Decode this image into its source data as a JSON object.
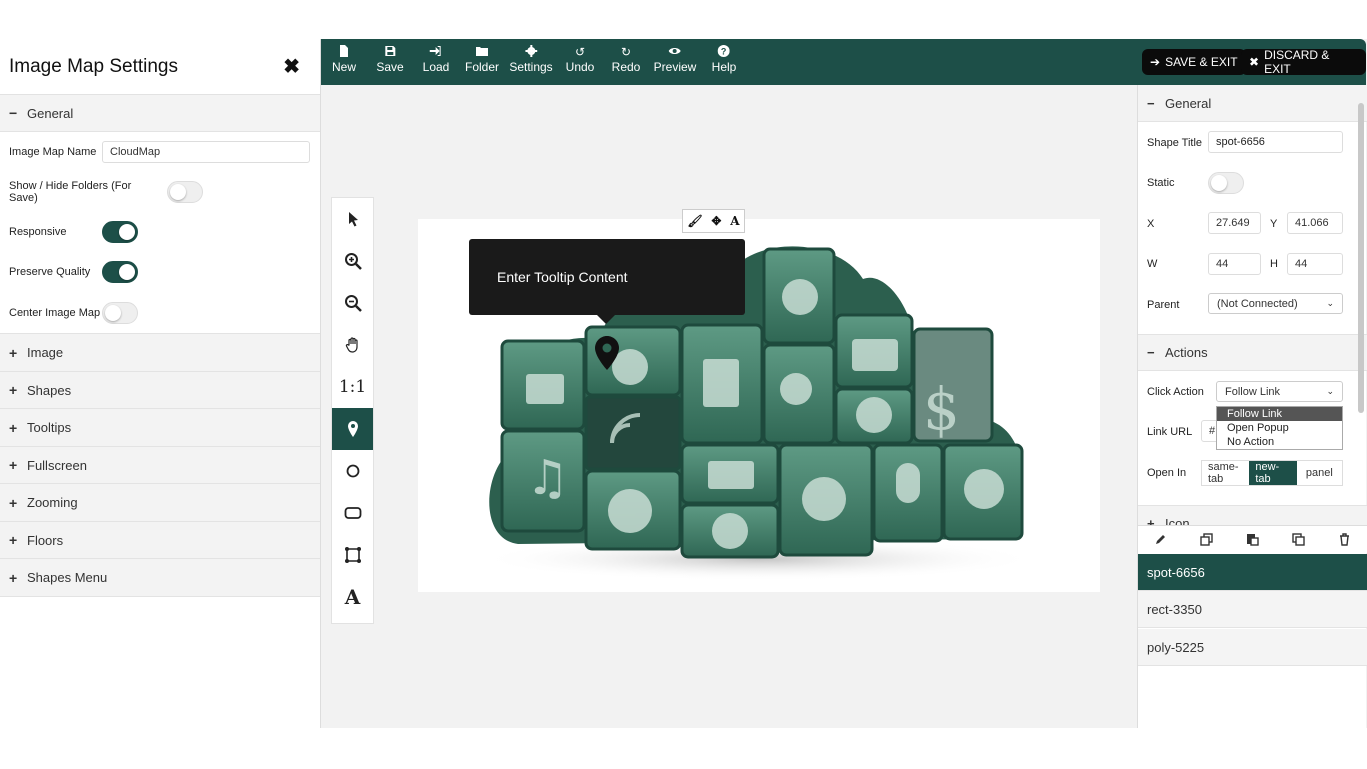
{
  "left_panel": {
    "title": "Image Map Settings",
    "general_section": "General",
    "image_map_name_label": "Image Map Name",
    "image_map_name_value": "CloudMap",
    "show_hide_folders_label": "Show / Hide Folders (For Save)",
    "show_hide_folders_on": false,
    "responsive_label": "Responsive",
    "responsive_on": true,
    "preserve_quality_label": "Preserve Quality",
    "preserve_quality_on": true,
    "center_image_map_label": "Center Image Map",
    "center_image_map_on": false,
    "sections": [
      "Image",
      "Shapes",
      "Tooltips",
      "Fullscreen",
      "Zooming",
      "Floors",
      "Shapes Menu"
    ]
  },
  "toolbar": {
    "buttons": [
      "New",
      "Save",
      "Load",
      "Folder",
      "Settings",
      "Undo",
      "Redo",
      "Preview",
      "Help"
    ],
    "save_exit": "SAVE & EXIT",
    "discard_exit": "DISCARD & EXIT"
  },
  "tools": [
    "select-arrow",
    "zoom-in",
    "zoom-out",
    "pan-hand",
    "actual-size",
    "spot-pin",
    "circle",
    "rounded-rect",
    "polygon",
    "text"
  ],
  "tools_actual_size_label": "1:1",
  "active_tool": "spot-pin",
  "canvas": {
    "tooltip_text": "Enter Tooltip Content",
    "shape_toolbar": [
      "brush",
      "move",
      "A"
    ]
  },
  "right_panel": {
    "general_section": "General",
    "shape_title_label": "Shape Title",
    "shape_title_value": "spot-6656",
    "static_label": "Static",
    "static_on": false,
    "x_label": "X",
    "x_value": "27.649",
    "y_label": "Y",
    "y_value": "41.066",
    "w_label": "W",
    "w_value": "44",
    "h_label": "H",
    "h_value": "44",
    "parent_label": "Parent",
    "parent_value": "(Not Connected)",
    "actions_section": "Actions",
    "click_action_label": "Click Action",
    "click_action_value": "Follow Link",
    "click_action_options": [
      "Follow Link",
      "Open Popup",
      "No Action"
    ],
    "link_url_label": "Link URL",
    "link_url_value": "#",
    "open_in_label": "Open In",
    "open_in_options": [
      "same-tab",
      "new-tab",
      "panel"
    ],
    "open_in_selected": "new-tab",
    "icon_section": "Icon",
    "shapes": [
      "spot-6656",
      "rect-3350",
      "poly-5225"
    ],
    "selected_shape": "spot-6656"
  },
  "colors": {
    "accent": "#1d4f48",
    "cloud_green": "#3f7d69",
    "tooltip_bg": "#1a1a1a"
  }
}
